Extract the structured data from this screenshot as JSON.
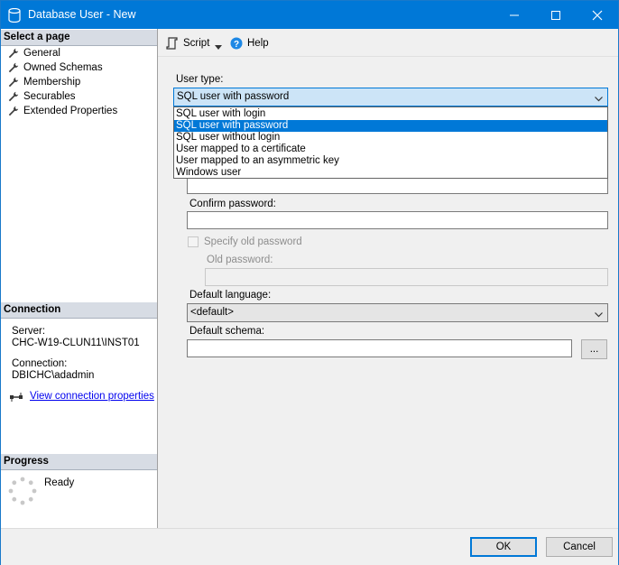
{
  "window": {
    "title": "Database User - New"
  },
  "left": {
    "select_page_header": "Select a page",
    "pages": [
      {
        "label": "General"
      },
      {
        "label": "Owned Schemas"
      },
      {
        "label": "Membership"
      },
      {
        "label": "Securables"
      },
      {
        "label": "Extended Properties"
      }
    ],
    "connection_header": "Connection",
    "server_label": "Server:",
    "server_value": "CHC-W19-CLUN11\\INST01",
    "connection_label": "Connection:",
    "connection_value": "DBICHC\\adadmin",
    "view_connection_link": "View connection properties",
    "progress_header": "Progress",
    "progress_status": "Ready"
  },
  "toolbar": {
    "script_label": "Script",
    "help_label": "Help"
  },
  "form": {
    "user_type_label": "User type:",
    "user_type_value": "SQL user with password",
    "user_type_options": [
      {
        "label": "SQL user with login",
        "selected": false
      },
      {
        "label": "SQL user with password",
        "selected": true
      },
      {
        "label": "SQL user without login",
        "selected": false
      },
      {
        "label": "User mapped to a certificate",
        "selected": false
      },
      {
        "label": "User mapped to an asymmetric key",
        "selected": false
      },
      {
        "label": "Windows user",
        "selected": false
      }
    ],
    "password_value": "",
    "confirm_password_label": "Confirm password:",
    "confirm_password_value": "",
    "specify_old_password_label": "Specify old password",
    "specify_old_password_checked": false,
    "old_password_label": "Old password:",
    "old_password_value": "",
    "default_language_label": "Default language:",
    "default_language_value": "<default>",
    "default_schema_label": "Default schema:",
    "default_schema_value": "",
    "browse_label": "..."
  },
  "buttons": {
    "ok": "OK",
    "cancel": "Cancel"
  },
  "colors": {
    "titlebar": "#0078d7",
    "section_header": "#d7dce4",
    "selection": "#0078d7",
    "link": "#0000ee"
  }
}
